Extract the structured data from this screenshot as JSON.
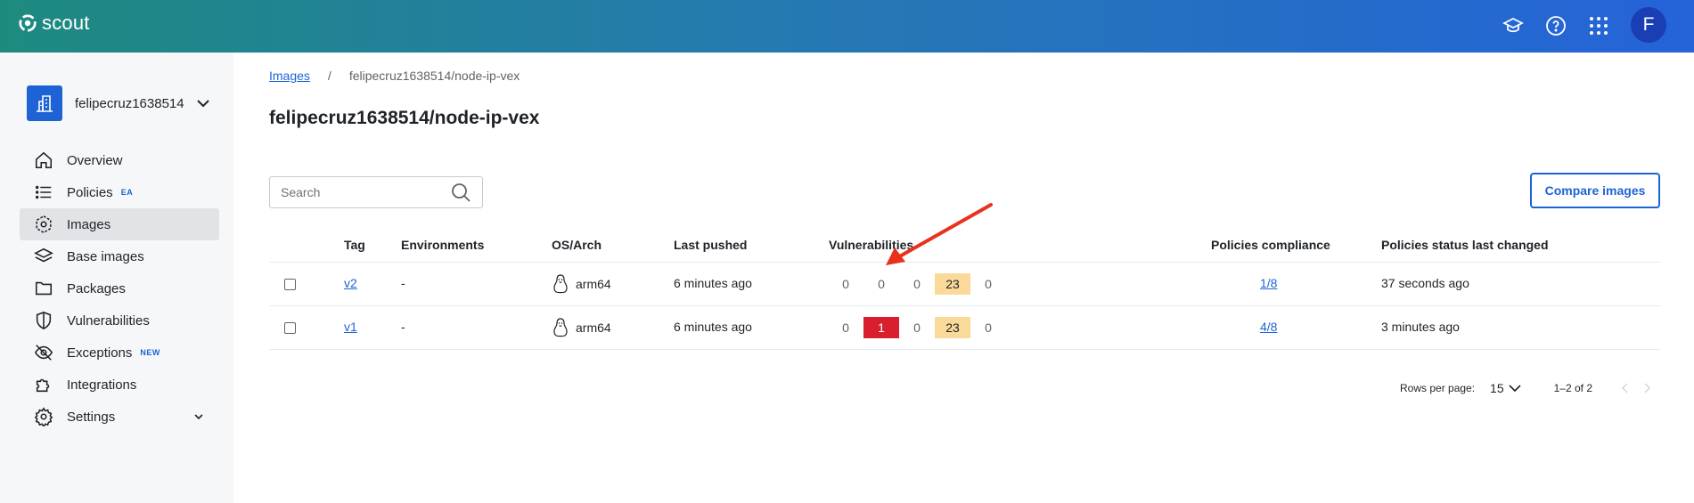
{
  "app": {
    "name": "scout"
  },
  "header": {
    "icons": [
      "learn-icon",
      "help-icon",
      "apps-grid-icon"
    ],
    "avatar_initial": "F"
  },
  "sidebar": {
    "org_name": "felipecruz1638514",
    "items": [
      {
        "label": "Overview",
        "icon": "home-icon"
      },
      {
        "label": "Policies",
        "icon": "list-icon",
        "badge": "EA"
      },
      {
        "label": "Images",
        "icon": "images-icon",
        "active": true
      },
      {
        "label": "Base images",
        "icon": "layers-icon"
      },
      {
        "label": "Packages",
        "icon": "folder-icon"
      },
      {
        "label": "Vulnerabilities",
        "icon": "shield-icon"
      },
      {
        "label": "Exceptions",
        "icon": "eye-off-icon",
        "badge": "NEW"
      },
      {
        "label": "Integrations",
        "icon": "puzzle-icon"
      },
      {
        "label": "Settings",
        "icon": "gear-icon",
        "expandable": true
      }
    ]
  },
  "breadcrumb": {
    "root": "Images",
    "separator": "/",
    "current": "felipecruz1638514/node-ip-vex"
  },
  "page_title": "felipecruz1638514/node-ip-vex",
  "search": {
    "placeholder": "Search"
  },
  "compare_button": "Compare images",
  "table": {
    "headers": {
      "tag": "Tag",
      "environments": "Environments",
      "os_arch": "OS/Arch",
      "last_pushed": "Last pushed",
      "vulnerabilities": "Vulnerabilities",
      "policies_compliance": "Policies compliance",
      "policies_status": "Policies status last changed"
    },
    "rows": [
      {
        "tag": "v2",
        "environments": "-",
        "os_arch": "arm64",
        "last_pushed": "6 minutes ago",
        "vulns": {
          "critical": "0",
          "high": "0",
          "medium": "0",
          "low": "23",
          "unspecified": "0"
        },
        "compliance": "1/8",
        "status_changed": "37 seconds ago"
      },
      {
        "tag": "v1",
        "environments": "-",
        "os_arch": "arm64",
        "last_pushed": "6 minutes ago",
        "vulns": {
          "critical": "0",
          "high": "1",
          "medium": "0",
          "low": "23",
          "unspecified": "0"
        },
        "compliance": "4/8",
        "status_changed": "3 minutes ago"
      }
    ]
  },
  "pagination": {
    "rows_label": "Rows per page:",
    "rows_value": "15",
    "range": "1–2 of 2"
  },
  "colors": {
    "accent": "#1d63d6",
    "critical": "#d81f2e",
    "low": "#fbd999",
    "annotation": "#e8321f"
  }
}
